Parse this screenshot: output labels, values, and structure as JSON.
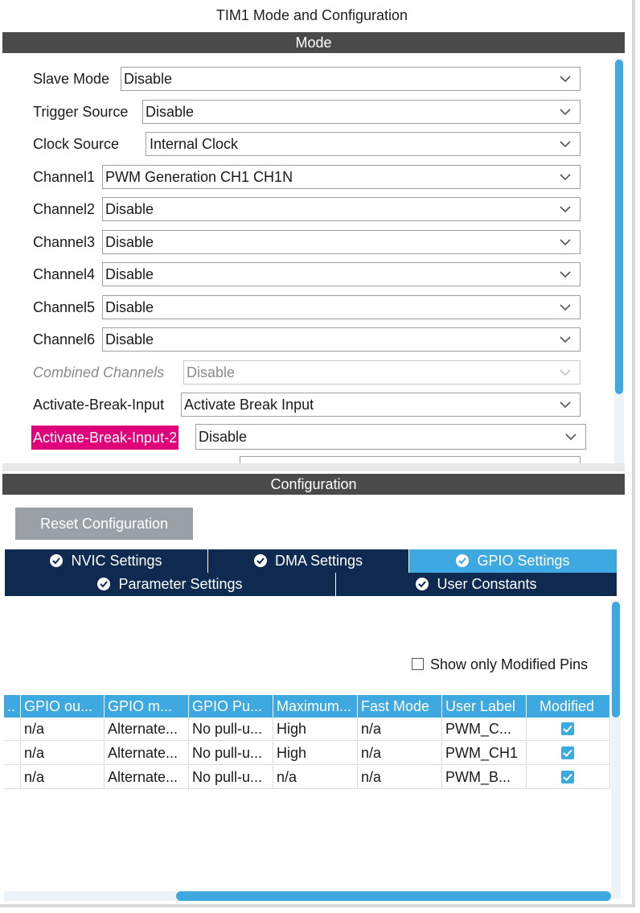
{
  "panel_title": "TIM1 Mode and Configuration",
  "mode_section": {
    "header": "Mode",
    "rows": [
      {
        "label": "Slave Mode",
        "value": "Disable"
      },
      {
        "label": "Trigger Source",
        "value": "Disable"
      },
      {
        "label": "Clock Source",
        "value": "Internal Clock"
      },
      {
        "label": "Channel1",
        "value": "PWM Generation CH1 CH1N"
      },
      {
        "label": "Channel2",
        "value": "Disable"
      },
      {
        "label": "Channel3",
        "value": "Disable"
      },
      {
        "label": "Channel4",
        "value": "Disable"
      },
      {
        "label": "Channel5",
        "value": "Disable"
      },
      {
        "label": "Channel6",
        "value": "Disable"
      },
      {
        "label": "Combined Channels",
        "value": "Disable"
      },
      {
        "label": "Activate-Break-Input",
        "value": "Activate Break Input"
      },
      {
        "label": "Activate-Break-Input-2",
        "value": "Disable"
      }
    ]
  },
  "config_section": {
    "header": "Configuration",
    "reset_button": "Reset Configuration",
    "tabs_row1": [
      {
        "label": "NVIC Settings",
        "active": false
      },
      {
        "label": "DMA Settings",
        "active": false
      },
      {
        "label": "GPIO Settings",
        "active": true
      }
    ],
    "tabs_row2": [
      {
        "label": "Parameter Settings",
        "active": false
      },
      {
        "label": "User Constants",
        "active": false
      }
    ],
    "show_modified_label": "Show only Modified Pins",
    "table": {
      "columns": [
        "..",
        "GPIO ou...",
        "GPIO m...",
        "GPIO Pu...",
        "Maximum...",
        "Fast Mode",
        "User Label",
        "Modified"
      ],
      "rows": [
        {
          "cells": [
            "",
            "n/a",
            "Alternate...",
            "No pull-u...",
            "High",
            "n/a",
            "PWM_C..."
          ],
          "modified": true
        },
        {
          "cells": [
            "",
            "n/a",
            "Alternate...",
            "No pull-u...",
            "High",
            "n/a",
            "PWM_CH1"
          ],
          "modified": true
        },
        {
          "cells": [
            "",
            "n/a",
            "Alternate...",
            "No pull-u...",
            "n/a",
            "n/a",
            "PWM_B..."
          ],
          "modified": true
        }
      ]
    }
  },
  "colors": {
    "accent_blue": "#3ea8e0",
    "navy_tab": "#0e2a50",
    "header_gray": "#4a4a4a",
    "highlight_pink": "#e0007a",
    "button_gray": "#9aa0a6"
  }
}
